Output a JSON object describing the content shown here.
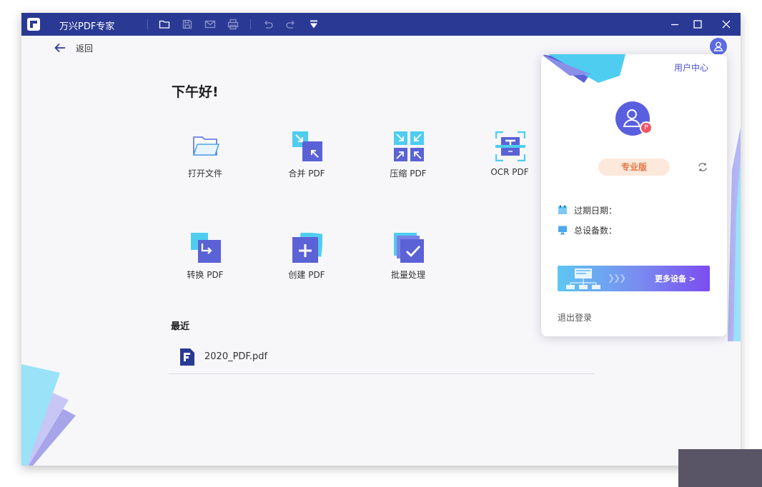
{
  "titlebar": {
    "app_title": "万兴PDF专家",
    "toolbar_icons": [
      "folder-icon",
      "save-icon",
      "mail-icon",
      "print-icon",
      "undo-icon",
      "redo-icon",
      "dropdown-icon"
    ],
    "window_controls": [
      "minimize-icon",
      "maximize-icon",
      "close-icon"
    ]
  },
  "nav": {
    "back_label": "返回"
  },
  "home": {
    "greeting": "下午好!",
    "tools": [
      {
        "label": "打开文件",
        "icon": "open-folder-icon"
      },
      {
        "label": "合并 PDF",
        "icon": "merge-pdf-icon"
      },
      {
        "label": "压缩 PDF",
        "icon": "compress-pdf-icon"
      },
      {
        "label": "OCR PDF",
        "icon": "ocr-pdf-icon"
      },
      {
        "label": "转换 PDF",
        "icon": "convert-pdf-icon"
      },
      {
        "label": "创建 PDF",
        "icon": "create-pdf-icon"
      },
      {
        "label": "批量处理",
        "icon": "batch-process-icon"
      }
    ],
    "recent": {
      "title": "最近",
      "files": [
        {
          "name": "2020_PDF.pdf",
          "icon": "pdf-file-icon"
        }
      ]
    }
  },
  "user_popup": {
    "user_center_link": "用户中心",
    "avatar_badge": "P",
    "plan_badge": "专业版",
    "expiry_label": "过期日期：",
    "devices_label": "总设备数：",
    "banner": {
      "arrows": "❯❯❯",
      "label": "更多设备 >"
    },
    "logout_label": "退出登录"
  },
  "colors": {
    "titlebar": "#2a3a94",
    "accent": "#5a5fe0",
    "pro_badge_bg": "#fde8dc",
    "pro_badge_text": "#e5753d"
  }
}
